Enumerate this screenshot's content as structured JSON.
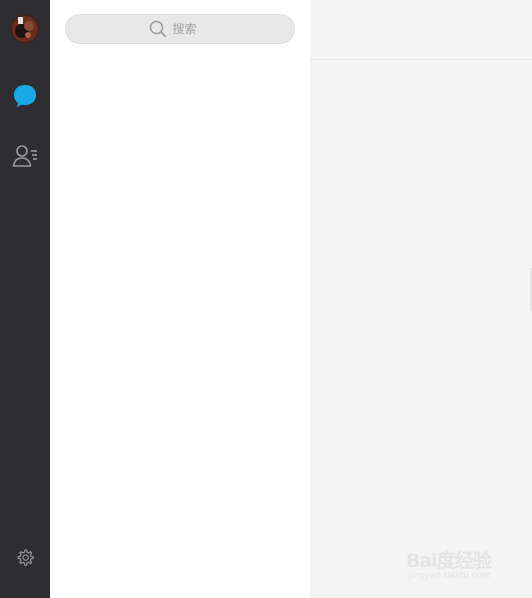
{
  "sidebar": {
    "avatar_name": "avatar",
    "nav": [
      {
        "icon": "chat-bubble-icon",
        "active": true
      },
      {
        "icon": "contacts-icon",
        "active": false
      }
    ],
    "settings_icon": "gear-icon"
  },
  "list_panel": {
    "search": {
      "placeholder": "搜索",
      "icon": "search-icon"
    }
  },
  "watermark": {
    "main_text": "Bai度经验",
    "sub_text": "jingyan.baidu.com"
  },
  "colors": {
    "sidebar_bg": "#2e2e32",
    "accent": "#1aa9e8",
    "list_bg": "#ffffff",
    "content_bg": "#f4f4f4"
  }
}
